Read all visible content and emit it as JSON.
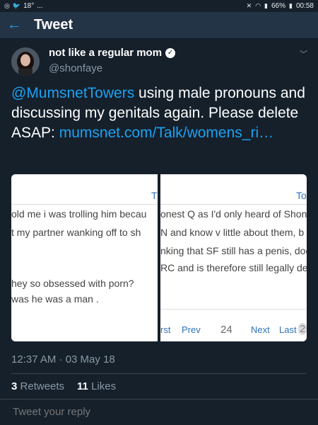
{
  "status_bar": {
    "temperature": "18°",
    "extra": "...",
    "battery_percent": "66%",
    "time": "00:58"
  },
  "header": {
    "title": "Tweet"
  },
  "author": {
    "name": "not like a regular mom",
    "handle": "@shonfaye"
  },
  "tweet": {
    "mention": "@MumsnetTowers",
    "text_middle": " using male pronouns and discussing my genitals again. Please delete ASAP: ",
    "link": "mumsnet.com/Talk/womens_ri…"
  },
  "media": {
    "left": {
      "header": "Th",
      "lines": [
        "old me i was trolling him becau",
        "t my partner wanking off to sh",
        "hey so obsessed with porn?",
        "was he was a man ."
      ]
    },
    "right": {
      "header": "To",
      "lines": [
        "onest Q as I'd only heard of Shon",
        "N and know v little about them, b",
        "nking that SF still has a penis, doe",
        "RC and is therefore still legally defi"
      ],
      "pager": {
        "first": "rst",
        "prev": "Prev",
        "page": "24",
        "next": "Next",
        "last": "Last",
        "badge": "2"
      }
    }
  },
  "meta": {
    "timestamp": "12:37 AM · 03 May 18"
  },
  "stats": {
    "retweets_count": "3",
    "retweets_label": "Retweets",
    "likes_count": "11",
    "likes_label": "Likes"
  },
  "reply": {
    "placeholder": "Tweet your reply"
  },
  "colors": {
    "background": "#15202b",
    "header": "#243447",
    "accent": "#1da1f2",
    "muted": "#8899a6"
  }
}
